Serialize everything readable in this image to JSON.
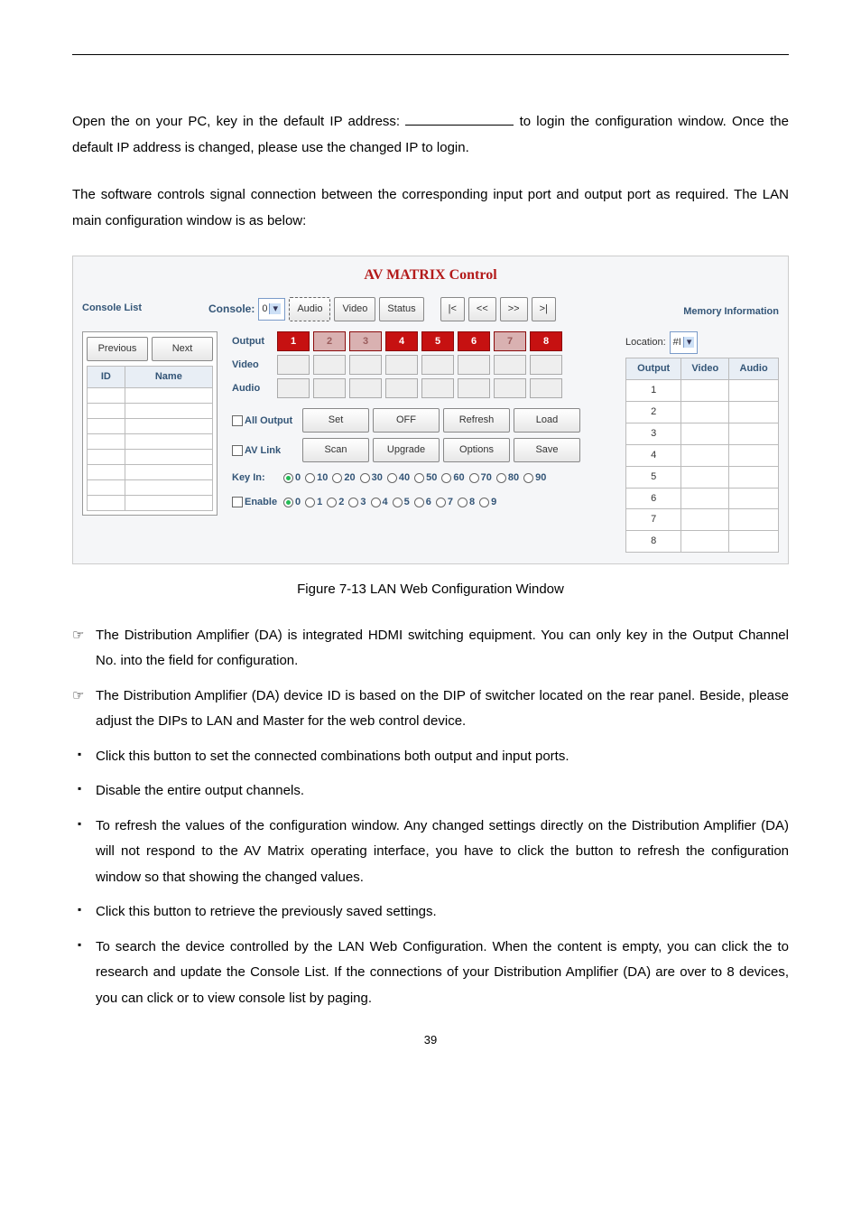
{
  "p1a": "Open the ",
  "p1b": " on your PC, key in the default IP address: ",
  "p1c": " to login the ",
  "p1d": " configuration window. Once the default IP address is changed, please use the changed IP to login.",
  "p2": "The software controls signal connection between the corresponding input port and output port as required. The LAN main configuration window is as below:",
  "shot": {
    "title": "AV MATRIX Control",
    "console_list": "Console List",
    "prev": "Previous",
    "next": "Next",
    "id": "ID",
    "name": "Name",
    "mem_info": "Memory Information",
    "console_lbl": "Console:",
    "console_val": "0",
    "audio_btn": "Audio",
    "video_btn": "Video",
    "status_btn": "Status",
    "nav_first": "|<",
    "nav_prev": "<<",
    "nav_next": ">>",
    "nav_last": ">|",
    "loc_lbl": "Location:",
    "loc_val": "#I",
    "row_output": "Output",
    "row_video": "Video",
    "row_audio": "Audio",
    "out_nums": [
      "1",
      "2",
      "3",
      "4",
      "5",
      "6",
      "7",
      "8"
    ],
    "red_idx": [
      0,
      3,
      4,
      5,
      7
    ],
    "all_output": "All Output",
    "av_link": "AV Link",
    "set": "Set",
    "off": "OFF",
    "refresh": "Refresh",
    "load": "Load",
    "scan": "Scan",
    "upgrade": "Upgrade",
    "options": "Options",
    "save": "Save",
    "keyin": "Key In:",
    "keyin_vals": [
      "0",
      "10",
      "20",
      "30",
      "40",
      "50",
      "60",
      "70",
      "80",
      "90"
    ],
    "enable": "Enable",
    "enable_vals": [
      "0",
      "1",
      "2",
      "3",
      "4",
      "5",
      "6",
      "7",
      "8",
      "9"
    ],
    "mem_output": "Output",
    "mem_video": "Video",
    "mem_audio": "Audio",
    "mem_rows": [
      "1",
      "2",
      "3",
      "4",
      "5",
      "6",
      "7",
      "8"
    ]
  },
  "figcap": "Figure 7-13 LAN Web Configuration Window",
  "note1a": "The Distribution Amplifier (DA) is integrated HDMI switching equipment. You can only key in the Output Channel No. into the ",
  "note1b": " field for configuration.",
  "note2": "The Distribution Amplifier (DA) device ID is based on the DIP of switcher located on the rear panel. Beside, please adjust the DIPs to LAN and Master for the web control device.",
  "note3": "Click this button to set the connected combinations both output and input ports.",
  "note4": "Disable the entire output channels.",
  "note5a": "To refresh the values of the configuration window. Any changed settings directly on the Distribution Amplifier (DA) will not respond to the AV Matrix operating interface, you have to click the ",
  "note5b": " button to refresh the configuration window so that showing the changed values.",
  "note6": "Click this button to retrieve the previously saved settings.",
  "note7a": "To search the device controlled by the LAN Web Configuration. When the ",
  "note7b": " content is empty, you can click the ",
  "note7c": " to research and update the Console List. If the connections of your Distribution Amplifier (DA) are over to 8 devices, you can click ",
  "note7d": " or ",
  "note7e": " to view console list by paging.",
  "pgnum": "39"
}
